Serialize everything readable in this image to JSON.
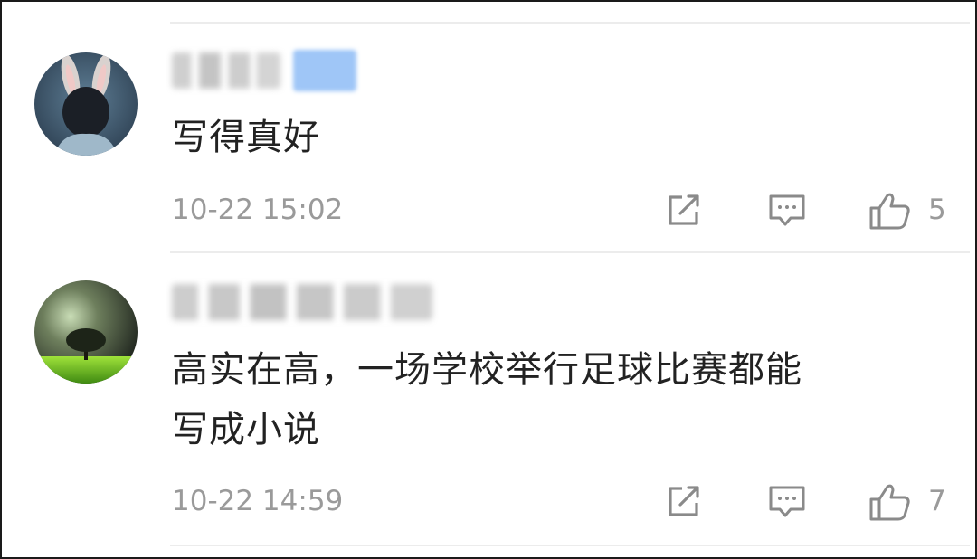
{
  "comments": [
    {
      "avatar": "bunny-ear-avatar",
      "username_blurred": true,
      "has_badge": true,
      "text": "写得真好",
      "timestamp": "10-22 15:02",
      "likes": "5"
    },
    {
      "avatar": "tree-landscape-avatar",
      "username_blurred": true,
      "has_badge": false,
      "text_lines": [
        "高实在高，一场学校举行足球比赛都能",
        "写成小说"
      ],
      "timestamp": "10-22 14:59",
      "likes": "7"
    }
  ],
  "icons": {
    "share": "share-icon",
    "reply": "comment-icon",
    "like": "thumbs-up-icon"
  },
  "colors": {
    "text": "#222222",
    "meta": "#9a9a9a",
    "icon": "#8a8a8a",
    "badge": "#9fc6f7",
    "divider": "#ececec"
  }
}
